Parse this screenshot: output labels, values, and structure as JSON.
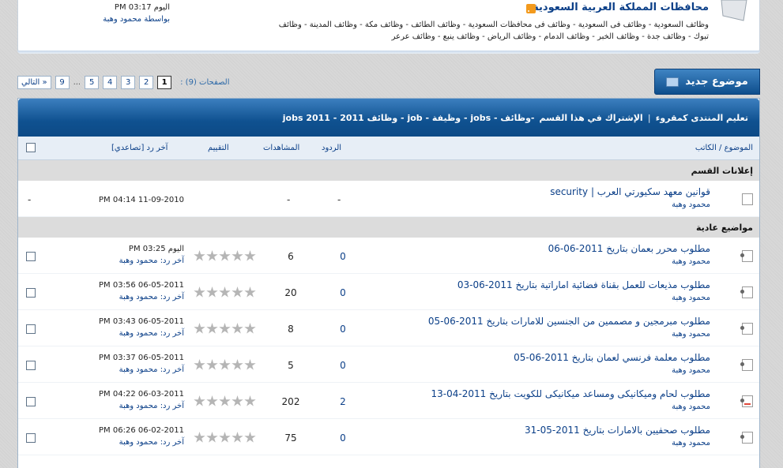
{
  "forum": {
    "title": "محافظات المملكة العربية السعودية",
    "sub_links": "وظائف السعودية - وظائف فى السعودية - وظائف فى محافظات السعودية - وظائف الطائف - وظائف مكة - وظائف المدينة - وظائف تبوك - وظائف جدة - وظائف الخبر - وظائف الدمام - وظائف الرياض - وظائف ينبع - وظائف عرعر",
    "last_post_time": "اليوم 03:17 PM",
    "last_post_by": "بواسطة محمود وهبة"
  },
  "pagination": {
    "label": "الصفحات (9) :",
    "pages": [
      "1",
      "2",
      "3",
      "4",
      "5"
    ],
    "ellipsis": "...",
    "last": "9",
    "next": "التالي »",
    "current": "1"
  },
  "new_topic_label": "موضوع جديد",
  "table_header": {
    "part1": "تعليم المنتدى كمقروء",
    "sep": "|",
    "part2": "الإشتراك في هذا القسم",
    "title": "-وظائف - jobs - وظيفة - job - وظائف 2011 - jobs 2011"
  },
  "columns": {
    "topic": "الموضوع / الكاتب",
    "replies": "الردود",
    "views": "المشاهدات",
    "rating": "التقييم",
    "last_reply": "آخر رد [تصاعدي]"
  },
  "sections": {
    "announcements": "إعلانات القسم",
    "normal": "مواضيع عادية"
  },
  "announcement": {
    "title": "قوانين معهد سكيورتي العرب | security",
    "author": "محمود وهبة",
    "replies": "-",
    "views": "-",
    "last": "11-09-2010 04:14 PM",
    "extra": "-"
  },
  "threads": [
    {
      "title": "مطلوب محرر بعمان بتاريخ 2011-06-06",
      "author": "محمود وهبة",
      "replies": "0",
      "views": "6",
      "lp_time": "اليوم 03:25 PM",
      "lp_by": "آخر رد: محمود وهبة",
      "rating": 0
    },
    {
      "title": "مطلوب مذيعات للعمل بقناة فضائية اماراتية بتاريخ 2011-06-03",
      "author": "محمود وهبة",
      "replies": "0",
      "views": "20",
      "lp_time": "06-05-2011 03:56 PM",
      "lp_by": "آخر رد: محمود وهبة",
      "rating": 0
    },
    {
      "title": "مطلوب مبرمجين و مصممين من الجنسين للامارات بتاريخ 2011-06-05",
      "author": "محمود وهبة",
      "replies": "0",
      "views": "8",
      "lp_time": "06-05-2011 03:43 PM",
      "lp_by": "آخر رد: محمود وهبة",
      "rating": 0
    },
    {
      "title": "مطلوب معلمة فرنسي لعمان بتاريخ 2011-06-05",
      "author": "محمود وهبة",
      "replies": "0",
      "views": "5",
      "lp_time": "06-05-2011 03:37 PM",
      "lp_by": "آخر رد: محمود وهبة",
      "rating": 0
    },
    {
      "title": "مطلوب لحام وميكانيكى ومساعد ميكانيكى للكويت بتاريخ 2011-04-13",
      "author": "محمود وهبة",
      "replies": "2",
      "views": "202",
      "lp_time": "06-03-2011 04:22 PM",
      "lp_by": "آخر رد: محمود وهبة",
      "rating": 0
    },
    {
      "title": "مطلوب صحفيين بالامارات بتاريخ 2011-05-31",
      "author": "محمود وهبة",
      "replies": "0",
      "views": "75",
      "lp_time": "06-02-2011 06:26 PM",
      "lp_by": "آخر رد: محمود وهبة",
      "rating": 0
    }
  ],
  "colors": {
    "header_blue": "#0f5190",
    "link_blue": "#0b3f88"
  }
}
